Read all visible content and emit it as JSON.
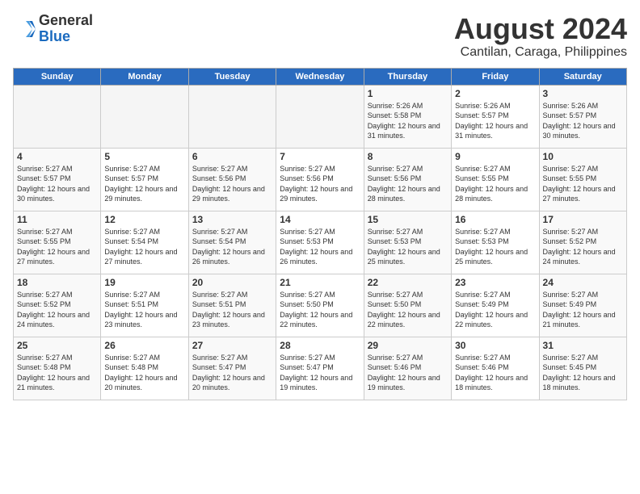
{
  "logo": {
    "general": "General",
    "blue": "Blue"
  },
  "title": {
    "month_year": "August 2024",
    "location": "Cantilan, Caraga, Philippines"
  },
  "headers": [
    "Sunday",
    "Monday",
    "Tuesday",
    "Wednesday",
    "Thursday",
    "Friday",
    "Saturday"
  ],
  "weeks": [
    [
      {
        "num": "",
        "content": ""
      },
      {
        "num": "",
        "content": ""
      },
      {
        "num": "",
        "content": ""
      },
      {
        "num": "",
        "content": ""
      },
      {
        "num": "1",
        "content": "Sunrise: 5:26 AM\nSunset: 5:58 PM\nDaylight: 12 hours\nand 31 minutes."
      },
      {
        "num": "2",
        "content": "Sunrise: 5:26 AM\nSunset: 5:57 PM\nDaylight: 12 hours\nand 31 minutes."
      },
      {
        "num": "3",
        "content": "Sunrise: 5:26 AM\nSunset: 5:57 PM\nDaylight: 12 hours\nand 30 minutes."
      }
    ],
    [
      {
        "num": "4",
        "content": "Sunrise: 5:27 AM\nSunset: 5:57 PM\nDaylight: 12 hours\nand 30 minutes."
      },
      {
        "num": "5",
        "content": "Sunrise: 5:27 AM\nSunset: 5:57 PM\nDaylight: 12 hours\nand 29 minutes."
      },
      {
        "num": "6",
        "content": "Sunrise: 5:27 AM\nSunset: 5:56 PM\nDaylight: 12 hours\nand 29 minutes."
      },
      {
        "num": "7",
        "content": "Sunrise: 5:27 AM\nSunset: 5:56 PM\nDaylight: 12 hours\nand 29 minutes."
      },
      {
        "num": "8",
        "content": "Sunrise: 5:27 AM\nSunset: 5:56 PM\nDaylight: 12 hours\nand 28 minutes."
      },
      {
        "num": "9",
        "content": "Sunrise: 5:27 AM\nSunset: 5:55 PM\nDaylight: 12 hours\nand 28 minutes."
      },
      {
        "num": "10",
        "content": "Sunrise: 5:27 AM\nSunset: 5:55 PM\nDaylight: 12 hours\nand 27 minutes."
      }
    ],
    [
      {
        "num": "11",
        "content": "Sunrise: 5:27 AM\nSunset: 5:55 PM\nDaylight: 12 hours\nand 27 minutes."
      },
      {
        "num": "12",
        "content": "Sunrise: 5:27 AM\nSunset: 5:54 PM\nDaylight: 12 hours\nand 27 minutes."
      },
      {
        "num": "13",
        "content": "Sunrise: 5:27 AM\nSunset: 5:54 PM\nDaylight: 12 hours\nand 26 minutes."
      },
      {
        "num": "14",
        "content": "Sunrise: 5:27 AM\nSunset: 5:53 PM\nDaylight: 12 hours\nand 26 minutes."
      },
      {
        "num": "15",
        "content": "Sunrise: 5:27 AM\nSunset: 5:53 PM\nDaylight: 12 hours\nand 25 minutes."
      },
      {
        "num": "16",
        "content": "Sunrise: 5:27 AM\nSunset: 5:53 PM\nDaylight: 12 hours\nand 25 minutes."
      },
      {
        "num": "17",
        "content": "Sunrise: 5:27 AM\nSunset: 5:52 PM\nDaylight: 12 hours\nand 24 minutes."
      }
    ],
    [
      {
        "num": "18",
        "content": "Sunrise: 5:27 AM\nSunset: 5:52 PM\nDaylight: 12 hours\nand 24 minutes."
      },
      {
        "num": "19",
        "content": "Sunrise: 5:27 AM\nSunset: 5:51 PM\nDaylight: 12 hours\nand 23 minutes."
      },
      {
        "num": "20",
        "content": "Sunrise: 5:27 AM\nSunset: 5:51 PM\nDaylight: 12 hours\nand 23 minutes."
      },
      {
        "num": "21",
        "content": "Sunrise: 5:27 AM\nSunset: 5:50 PM\nDaylight: 12 hours\nand 22 minutes."
      },
      {
        "num": "22",
        "content": "Sunrise: 5:27 AM\nSunset: 5:50 PM\nDaylight: 12 hours\nand 22 minutes."
      },
      {
        "num": "23",
        "content": "Sunrise: 5:27 AM\nSunset: 5:49 PM\nDaylight: 12 hours\nand 22 minutes."
      },
      {
        "num": "24",
        "content": "Sunrise: 5:27 AM\nSunset: 5:49 PM\nDaylight: 12 hours\nand 21 minutes."
      }
    ],
    [
      {
        "num": "25",
        "content": "Sunrise: 5:27 AM\nSunset: 5:48 PM\nDaylight: 12 hours\nand 21 minutes."
      },
      {
        "num": "26",
        "content": "Sunrise: 5:27 AM\nSunset: 5:48 PM\nDaylight: 12 hours\nand 20 minutes."
      },
      {
        "num": "27",
        "content": "Sunrise: 5:27 AM\nSunset: 5:47 PM\nDaylight: 12 hours\nand 20 minutes."
      },
      {
        "num": "28",
        "content": "Sunrise: 5:27 AM\nSunset: 5:47 PM\nDaylight: 12 hours\nand 19 minutes."
      },
      {
        "num": "29",
        "content": "Sunrise: 5:27 AM\nSunset: 5:46 PM\nDaylight: 12 hours\nand 19 minutes."
      },
      {
        "num": "30",
        "content": "Sunrise: 5:27 AM\nSunset: 5:46 PM\nDaylight: 12 hours\nand 18 minutes."
      },
      {
        "num": "31",
        "content": "Sunrise: 5:27 AM\nSunset: 5:45 PM\nDaylight: 12 hours\nand 18 minutes."
      }
    ]
  ]
}
